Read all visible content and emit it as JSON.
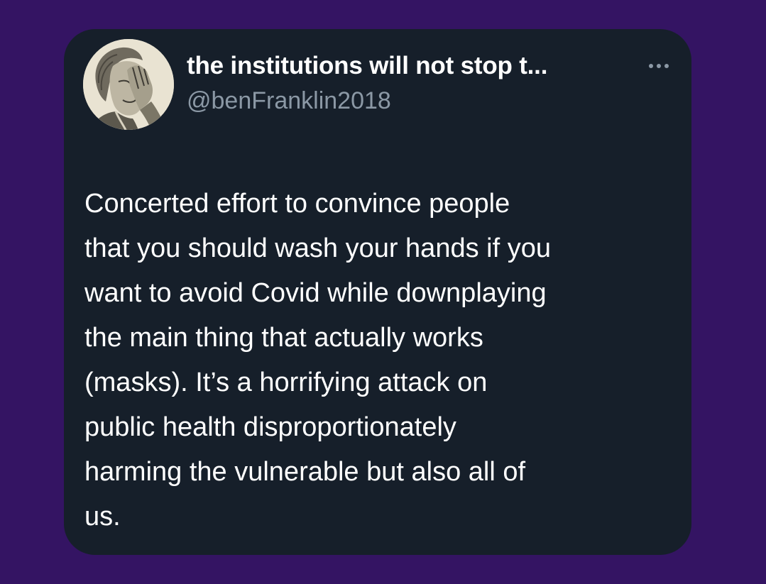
{
  "tweet": {
    "author": {
      "display_name": "the institutions will not stop t...",
      "handle": "@benFranklin2018",
      "avatar_icon": "ben-franklin-facepalm-avatar"
    },
    "more_icon": "more-options-icon",
    "text": "Concerted effort to convince people\nthat you should wash your hands if you\nwant to avoid Covid while downplaying\nthe main thing that actually works\n(masks). It’s a horrifying attack on\npublic health disproportionately\nharming the vulnerable but also all of\nus."
  },
  "colors": {
    "page_background": "#341463",
    "card_background": "#161f2a",
    "text_primary": "#ffffff",
    "text_secondary": "#8b98a5"
  }
}
